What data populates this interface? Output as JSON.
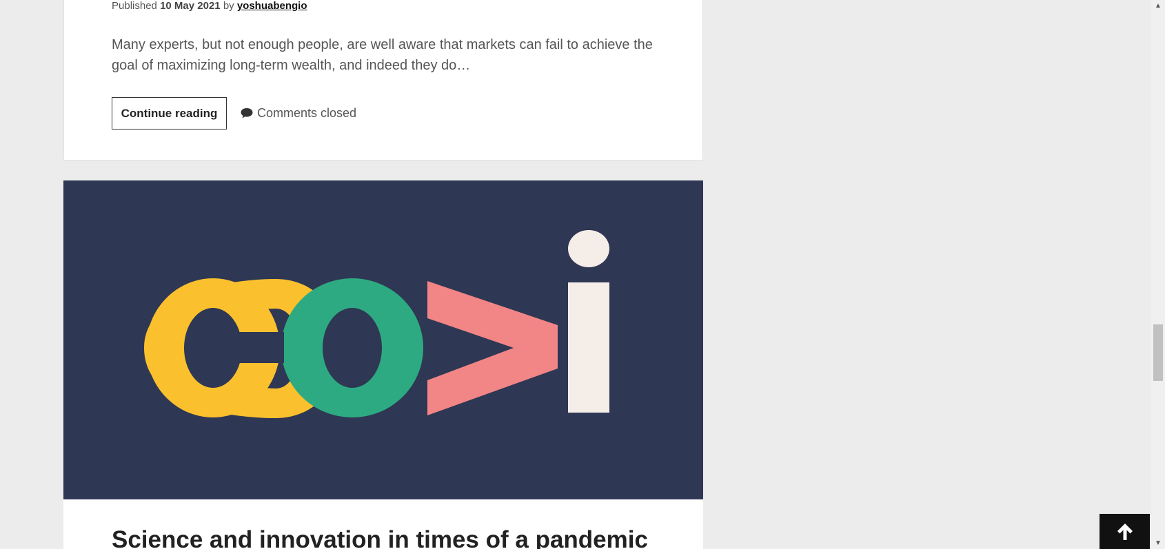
{
  "post1": {
    "meta_prefix": "Published",
    "date": "10 May 2021",
    "by": "by",
    "author": "yoshuabengio",
    "excerpt": "Many experts, but not enough people, are well aware that markets can fail to achieve the goal of maximizing long-term wealth, and indeed they do…",
    "continue_label": "Continue reading",
    "comments_label": "Comments closed"
  },
  "post2": {
    "image_icon": "covi-logo",
    "title": "Science and innovation in times of a pandemic"
  },
  "colors": {
    "image_bg": "#2e3753",
    "logo_c": "#fbc02d",
    "logo_o": "#2eaa82",
    "logo_v": "#f28585",
    "logo_i": "#f5ede8"
  },
  "back_to_top_icon": "arrow-up-icon"
}
